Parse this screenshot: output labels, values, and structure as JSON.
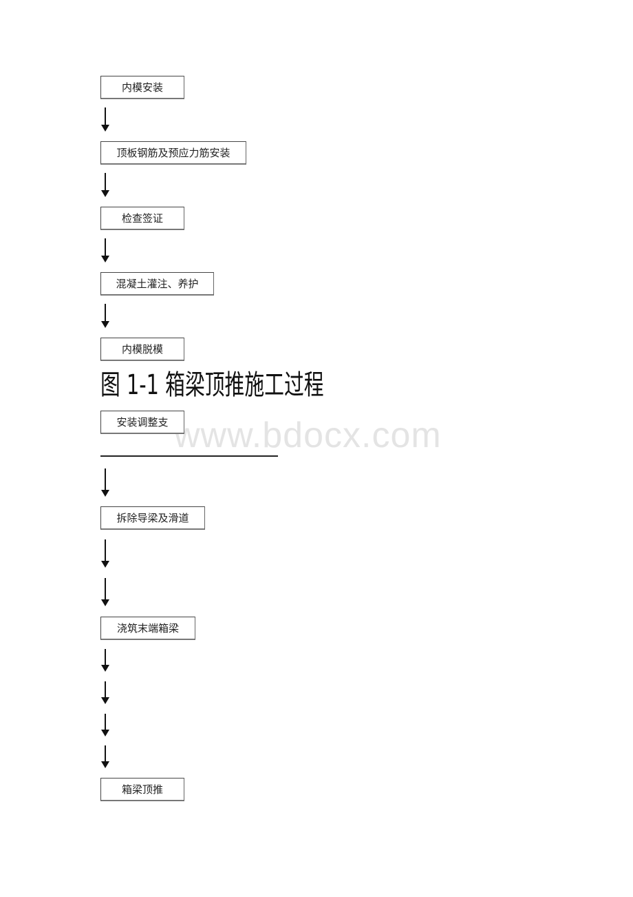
{
  "flowchart": {
    "steps": [
      "内模安装",
      "顶板钢筋及预应力筋安装",
      "检查签证",
      "混凝土灌注、养护",
      "内模脱模",
      "安装调整支",
      "拆除导梁及滑道",
      "浇筑末端箱梁",
      "箱梁顶推"
    ],
    "caption": "图 1-1  箱梁顶推施工过程"
  },
  "watermark": "www.bdocx.com"
}
